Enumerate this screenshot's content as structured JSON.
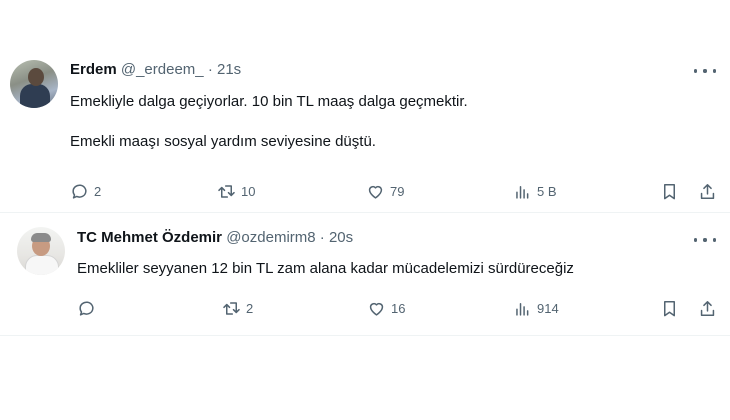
{
  "tweets": [
    {
      "name": "Erdem",
      "handle": "@_erdeem_",
      "separator": "·",
      "time": "21s",
      "text": "Emekliyle dalga geçiyorlar. 10 bin TL maaş dalga geçmektir.\n\nEmekli maaşı sosyal yardım seviyesine düştü.",
      "replies": "2",
      "retweets": "10",
      "likes": "79",
      "views": "5 B"
    },
    {
      "name": "TC Mehmet Özdemir",
      "handle": "@ozdemirm8",
      "separator": "·",
      "time": "20s",
      "text": "Emekliler seyyanen 12 bin TL zam alana kadar mücadelemizi sürdüreceğiz",
      "replies": "",
      "retweets": "2",
      "likes": "16",
      "views": "914"
    }
  ],
  "icons": {
    "reply": "reply-icon",
    "retweet": "retweet-icon",
    "like": "heart-icon",
    "views": "views-icon",
    "bookmark": "bookmark-icon",
    "share": "share-icon",
    "more": "more-icon"
  },
  "colors": {
    "text": "#0f1419",
    "muted": "#536471",
    "divider": "#eff3f4"
  }
}
